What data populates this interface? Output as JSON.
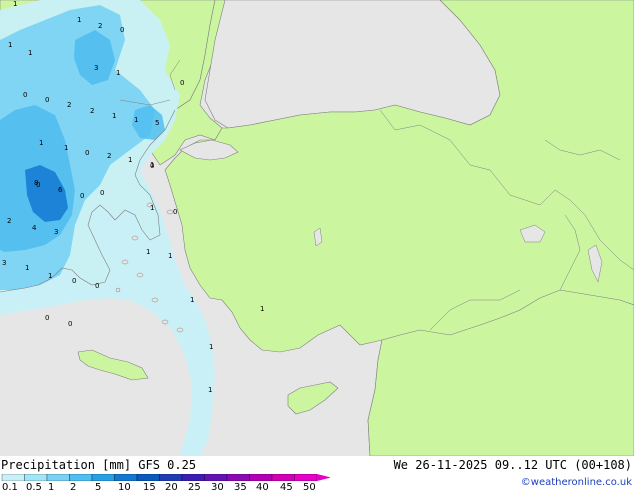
{
  "map": {
    "title": "Precipitation [mm]",
    "model": "GFS 0.25",
    "valid_time": "We 26-11-2025 09..12 UTC (00+108)",
    "credit": "©weatheronline.co.uk",
    "colors": {
      "sea": "#e6e6e6",
      "land": "#ccf5a0",
      "outside": "#e8e8e8",
      "border": "#7f7f7f"
    },
    "precip_labels": [
      {
        "text": "1"
      },
      {
        "text": "2"
      },
      {
        "text": "0"
      },
      {
        "text": "1"
      },
      {
        "text": "1"
      },
      {
        "text": "1"
      },
      {
        "text": "3"
      },
      {
        "text": "1"
      },
      {
        "text": "0"
      },
      {
        "text": "0"
      },
      {
        "text": "0"
      },
      {
        "text": "2"
      },
      {
        "text": "2"
      },
      {
        "text": "1"
      },
      {
        "text": "1"
      },
      {
        "text": "1"
      },
      {
        "text": "5"
      },
      {
        "text": "1"
      },
      {
        "text": "2"
      },
      {
        "text": "0"
      },
      {
        "text": "1"
      },
      {
        "text": "1"
      },
      {
        "text": "0"
      },
      {
        "text": "0"
      },
      {
        "text": "6"
      },
      {
        "text": "8"
      },
      {
        "text": "0"
      },
      {
        "text": "2"
      },
      {
        "text": "4"
      },
      {
        "text": "3"
      },
      {
        "text": "1"
      },
      {
        "text": "0"
      },
      {
        "text": "1"
      },
      {
        "text": "3"
      },
      {
        "text": "1"
      },
      {
        "text": "1"
      },
      {
        "text": "1"
      },
      {
        "text": "0"
      },
      {
        "text": "0"
      },
      {
        "text": "1"
      },
      {
        "text": "0"
      },
      {
        "text": "0"
      },
      {
        "text": "1"
      },
      {
        "text": "1"
      },
      {
        "text": "0"
      },
      {
        "text": "1"
      }
    ]
  },
  "legend": {
    "values": [
      "0.1",
      "0.5",
      "1",
      "2",
      "5",
      "10",
      "15",
      "20",
      "25",
      "30",
      "35",
      "40",
      "45",
      "50"
    ],
    "colors": [
      "#c8f0f8",
      "#a0e6f8",
      "#78d2f4",
      "#50bef0",
      "#28a0e6",
      "#1478d2",
      "#0a5abe",
      "#1e3cb4",
      "#3c1eb4",
      "#6414b4",
      "#8c0ab4",
      "#b400b4",
      "#d200b4",
      "#e600c8"
    ]
  }
}
